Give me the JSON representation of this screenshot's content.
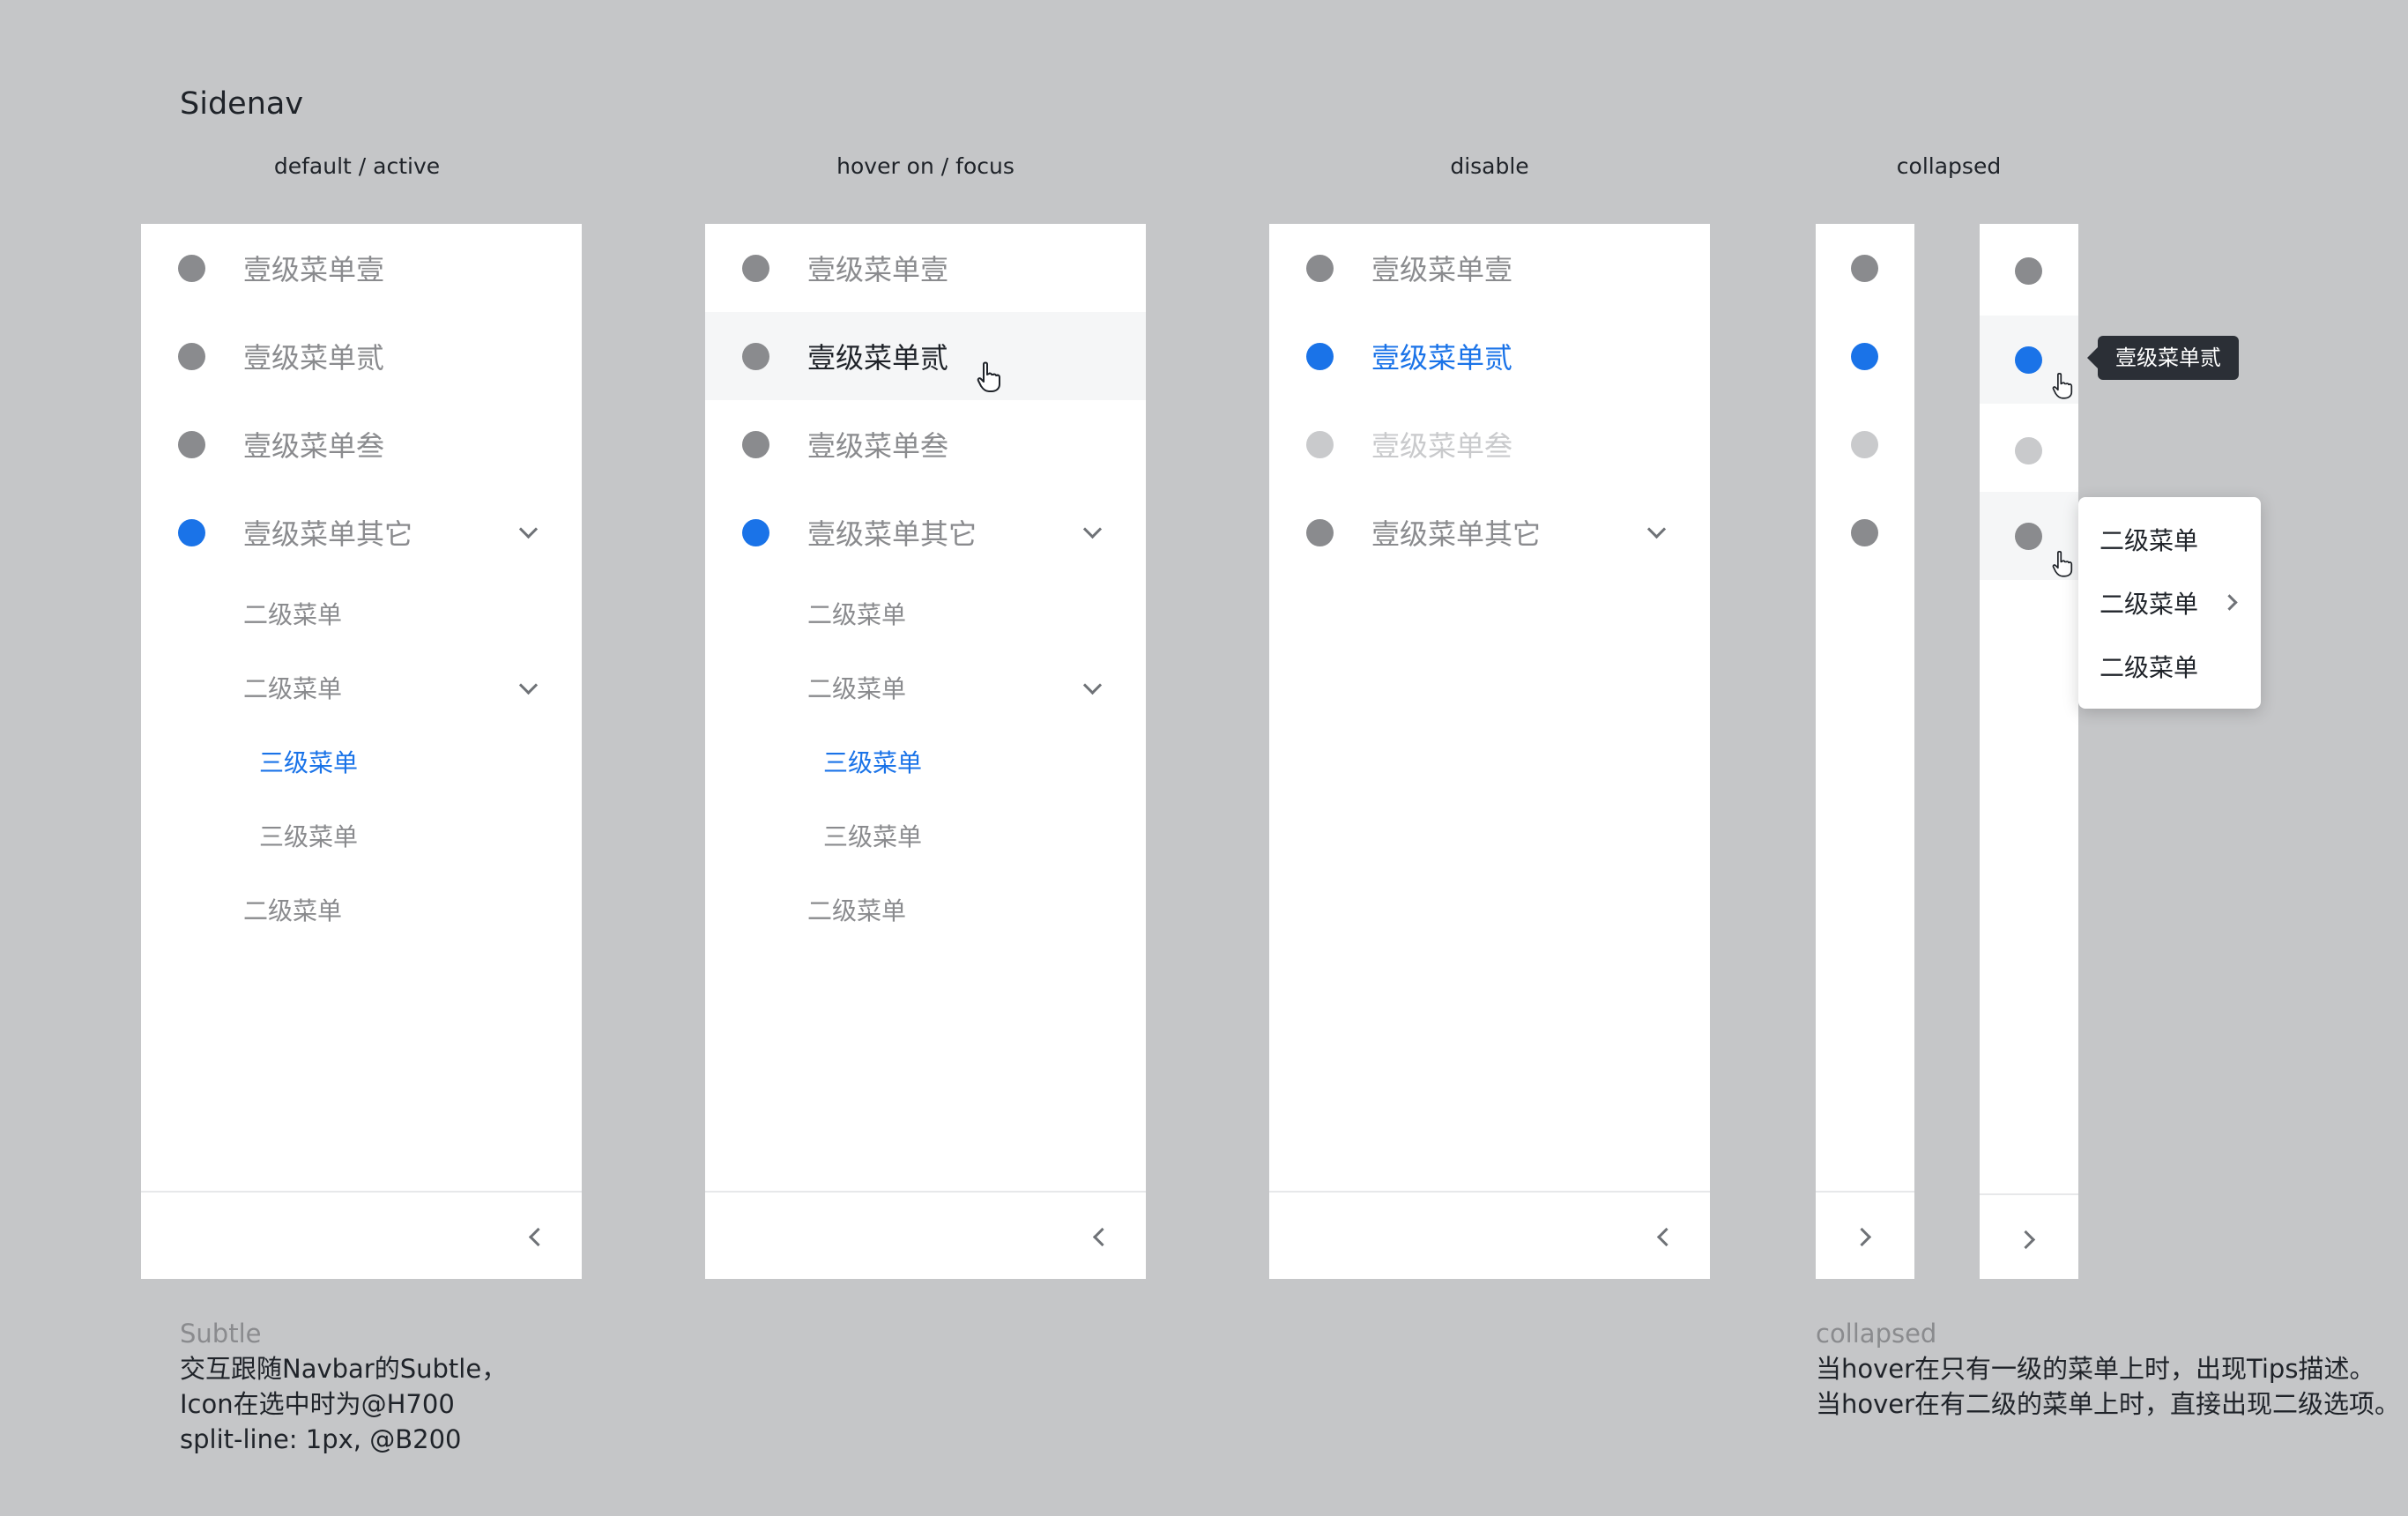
{
  "page": {
    "title": "Sidenav"
  },
  "columns": {
    "default": "default / active",
    "hover": "hover on / focus",
    "disable": "disable",
    "collapsed": "collapsed"
  },
  "menu": {
    "item1": "壹级菜单壹",
    "item2": "壹级菜单贰",
    "item3": "壹级菜单叁",
    "item4": "壹级菜单其它",
    "sub": "二级菜单",
    "third": "三级菜单"
  },
  "tooltip": {
    "text": "壹级菜单贰"
  },
  "popup": {
    "items": [
      "二级菜单",
      "二级菜单",
      "二级菜单"
    ]
  },
  "notes": {
    "left": {
      "heading": "Subtle",
      "line1": "交互跟随Navbar的Subtle，",
      "line2": "Icon在选中时为@H700",
      "line3": "split-line: 1px, @B200"
    },
    "right": {
      "heading": "collapsed",
      "line1": "当hover在只有一级的菜单上时，出现Tips描述。",
      "line2": "当hover在有二级的菜单上时，直接出现二级选项。"
    }
  },
  "colors": {
    "background": "#c5c6c8",
    "active": "#1a73e8",
    "icon": "#8a8b8e",
    "disabled": "#c9cacc",
    "tooltip": "#2b2f36"
  }
}
